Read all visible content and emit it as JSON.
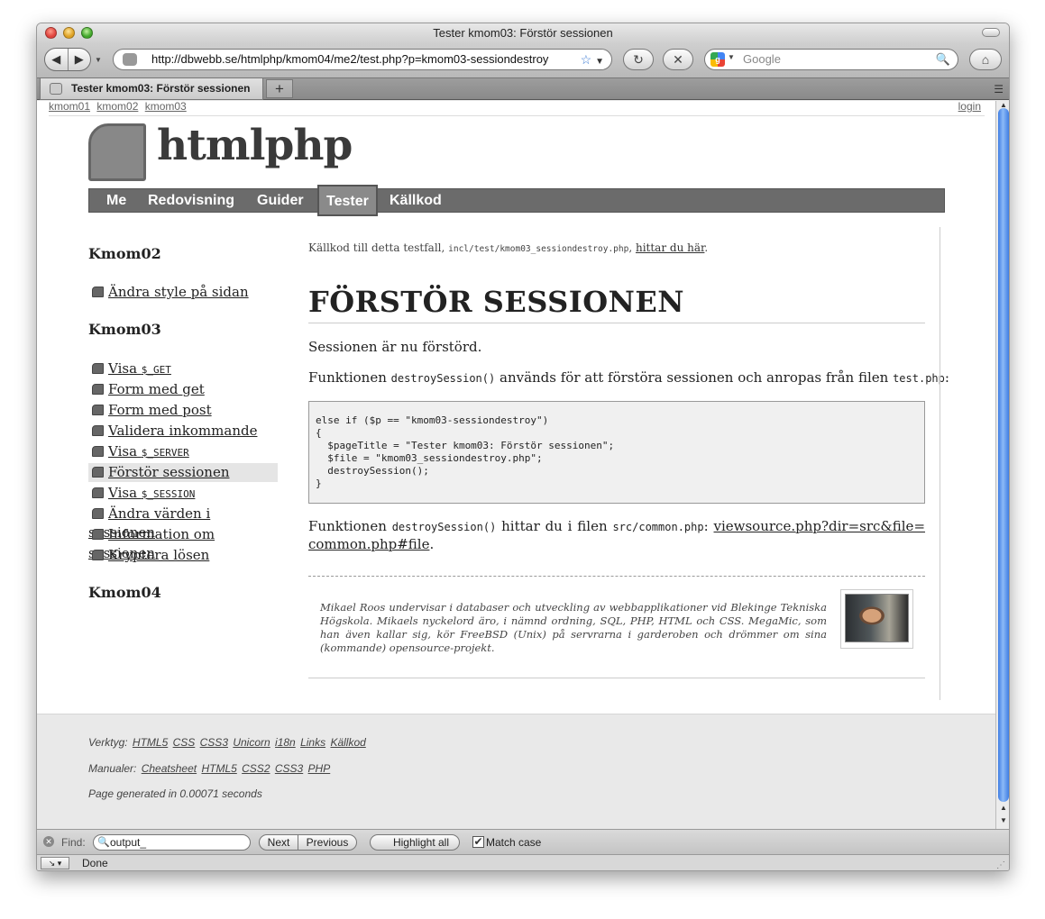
{
  "window": {
    "title": "Tester kmom03: Förstör sessionen"
  },
  "toolbar": {
    "back_icon": "◀",
    "forward_icon": "▶",
    "url": "http://dbwebb.se/htmlphp/kmom04/me2/test.php?p=kmom03-sessiondestroy",
    "bookmark_icon": "☆",
    "url_dropdown_icon": "▼",
    "reload_icon": "↻",
    "stop_icon": "✕",
    "search_placeholder": "Google",
    "search_icon": "🔍",
    "home_icon": "⌂"
  },
  "tabs": [
    {
      "label": "Tester kmom03: Förstör sessionen"
    }
  ],
  "tabbar": {
    "new_tab": "+"
  },
  "page": {
    "topnav": {
      "links": [
        "kmom01",
        "kmom02",
        "kmom03"
      ],
      "login": "login"
    },
    "site_title": "htmlphp",
    "menu": [
      "Me",
      "Redovisning",
      "Guider",
      "Tester",
      "Källkod"
    ],
    "menu_selected": "Tester",
    "sidebar": {
      "section1": "Kmom02",
      "items1": [
        {
          "label": "Ändra style på sidan"
        }
      ],
      "section2": "Kmom03",
      "items2": [
        {
          "label": "Visa ",
          "code": "$_GET"
        },
        {
          "label": "Form med get"
        },
        {
          "label": "Form med post"
        },
        {
          "label": "Validera inkommande"
        },
        {
          "label": "Visa ",
          "code": "$_SERVER"
        },
        {
          "label": "Förstör sessionen",
          "active": true
        },
        {
          "label": "Visa ",
          "code": "$_SESSION"
        },
        {
          "label": "Ändra värden i sessionen"
        },
        {
          "label": "Information om sessionen"
        },
        {
          "label": "Kryptera lösen"
        }
      ],
      "section3": "Kmom04"
    },
    "main": {
      "source_prefix": "Källkod till detta testfall, ",
      "source_file": "incl/test/kmom03_sessiondestroy.php",
      "source_sep": ", ",
      "source_link": "hittar du här",
      "source_end": ".",
      "heading": "FÖRSTÖR SESSIONEN",
      "p1": "Sessionen är nu förstörd.",
      "p2_a": "Funktionen ",
      "p2_code1": "destroySession()",
      "p2_b": " används för att förstöra sessionen och anropas från filen ",
      "p2_code2": "test.php",
      "p2_c": ":",
      "code_block": "else if ($p == \"kmom03-sessiondestroy\")\n{\n  $pageTitle = \"Tester kmom03: Förstör sessionen\";\n  $file = \"kmom03_sessiondestroy.php\";\n  destroySession();\n}",
      "p3_a": "Funktionen ",
      "p3_code1": "destroySession()",
      "p3_b": " hittar du i filen ",
      "p3_code2": "src/common.php",
      "p3_c": ": ",
      "p3_link": "viewsource.php?dir=src&file=common.php#file",
      "p3_d": ".",
      "bio": "Mikael Roos undervisar i databaser och utveckling av webbapplikationer vid Blekinge Tekniska Högskola. Mikaels nyckelord äro, i nämnd ordning, SQL, PHP, HTML och CSS. MegaMic, som han även kallar sig, kör FreeBSD (Unix) på servrarna i garderoben och drömmer om sina (kommande) opensource-projekt."
    },
    "footer": {
      "tools_label": "Verktyg:",
      "tools": [
        "HTML5",
        "CSS",
        "CSS3",
        "Unicorn",
        "i18n",
        "Links",
        "Källkod"
      ],
      "manuals_label": "Manualer:",
      "manuals": [
        "Cheatsheet",
        "HTML5",
        "CSS2",
        "CSS3",
        "PHP"
      ],
      "generated": "Page generated in 0.00071 seconds"
    }
  },
  "findbar": {
    "label": "Find:",
    "value": "output_",
    "next": "Next",
    "previous": "Previous",
    "highlight": "Highlight all",
    "match_case": "Match case",
    "match_case_checked": true
  },
  "status": {
    "text": "Done"
  }
}
